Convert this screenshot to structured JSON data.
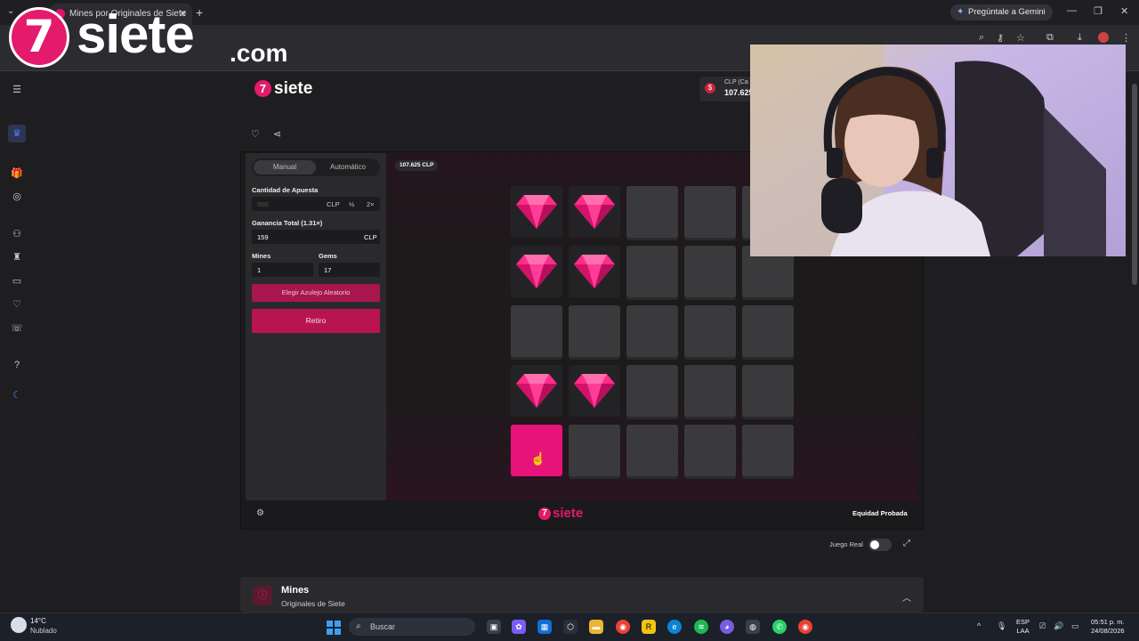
{
  "browser": {
    "tab_title": "Mines por Originales de Siete",
    "gemini_label": "Pregúntale a Gemini"
  },
  "overlay": {
    "brand_word": "siete",
    "brand_tld": ".com",
    "brand_mark": "7"
  },
  "site": {
    "logo_mark": "7",
    "logo_text": "siete",
    "balance_currency": "CLP (Ca",
    "balance_value": "107.625",
    "balance_coin": "$"
  },
  "game": {
    "tab_manual": "Manual",
    "tab_auto": "Automático",
    "bet_label": "Cantidad de Apuesta",
    "bet_value": "500",
    "bet_currency": "CLP",
    "bet_half": "½",
    "bet_double": "2×",
    "profit_label": "Ganancia Total (1.31×)",
    "profit_value": "159",
    "profit_currency": "CLP",
    "mines_label": "Mines",
    "mines_value": "1",
    "gems_label": "Gems",
    "gems_value": "17",
    "random_button": "Elegir Azulejo Aleatorio",
    "cashout_button": "Retiro",
    "board_balance": "107.625 CLP",
    "grid": [
      [
        "gem",
        "gem",
        "hidden",
        "hidden",
        "hidden"
      ],
      [
        "gem",
        "gem",
        "hidden",
        "hidden",
        "hidden"
      ],
      [
        "hidden",
        "hidden",
        "hidden",
        "hidden",
        "hidden"
      ],
      [
        "gem",
        "gem",
        "hidden",
        "hidden",
        "hidden"
      ],
      [
        "hit",
        "hidden",
        "hidden",
        "hidden",
        "hidden"
      ]
    ],
    "footer_logo_text": "siete",
    "footer_logo_mark": "7",
    "provably_fair": "Equidad Probada",
    "real_play_label": "Juego Real"
  },
  "info": {
    "title": "Mines",
    "subtitle": "Originales de Siete"
  },
  "taskbar": {
    "temp": "14°C",
    "weather": "Nublado",
    "search_placeholder": "Buscar",
    "lang_top": "ESP",
    "lang_bottom": "LAA",
    "time": "05:51 p. m.",
    "date": "24/08/2026"
  },
  "colors": {
    "brand_pink": "#e41a6c",
    "gem_pink": "#ff2d8a",
    "cashout": "#b8154f"
  }
}
